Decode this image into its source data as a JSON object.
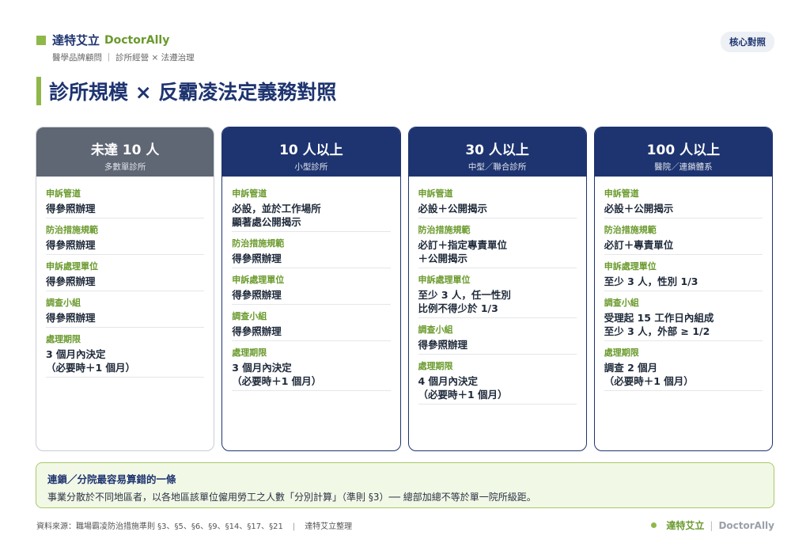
{
  "header": {
    "brand_cn": "達特艾立",
    "brand_en": "DoctorAlly",
    "brand_sub": "醫學品牌顧問 ｜ 診所經營 × 法遵治理",
    "tag": "核心對照"
  },
  "title": "診所規模 × 反霸凌法定義務對照",
  "cards": [
    {
      "title": "未達 10 人",
      "subtitle": "多數單診所",
      "items": [
        {
          "label": "申訴管道",
          "value": "得參照辦理"
        },
        {
          "label": "防治措施規範",
          "value": "得參照辦理"
        },
        {
          "label": "申訴處理單位",
          "value": "得參照辦理"
        },
        {
          "label": "調查小組",
          "value": "得參照辦理"
        },
        {
          "label": "處理期限",
          "value": "3 個月內決定\n（必要時＋1 個月）"
        }
      ]
    },
    {
      "title": "10 人以上",
      "subtitle": "小型診所",
      "items": [
        {
          "label": "申訴管道",
          "value": "必設，並於工作場所\n顯著處公開揭示"
        },
        {
          "label": "防治措施規範",
          "value": "得參照辦理"
        },
        {
          "label": "申訴處理單位",
          "value": "得參照辦理"
        },
        {
          "label": "調查小組",
          "value": "得參照辦理"
        },
        {
          "label": "處理期限",
          "value": "3 個月內決定\n（必要時＋1 個月）"
        }
      ]
    },
    {
      "title": "30 人以上",
      "subtitle": "中型／聯合診所",
      "items": [
        {
          "label": "申訴管道",
          "value": "必設＋公開揭示"
        },
        {
          "label": "防治措施規範",
          "value": "必訂＋指定專責單位\n＋公開揭示"
        },
        {
          "label": "申訴處理單位",
          "value": "至少 3 人，任一性別\n比例不得少於 1/3"
        },
        {
          "label": "調查小組",
          "value": "得參照辦理"
        },
        {
          "label": "處理期限",
          "value": "4 個月內決定\n（必要時＋1 個月）"
        }
      ]
    },
    {
      "title": "100 人以上",
      "subtitle": "醫院／連鎖體系",
      "items": [
        {
          "label": "申訴管道",
          "value": "必設＋公開揭示"
        },
        {
          "label": "防治措施規範",
          "value": "必訂＋專責單位"
        },
        {
          "label": "申訴處理單位",
          "value": "至少 3 人，性別 1/3"
        },
        {
          "label": "調查小組",
          "value": "受理起 15 工作日內組成\n至少 3 人，外部 ≥ 1/2"
        },
        {
          "label": "處理期限",
          "value": "調查 2 個月\n（必要時＋1 個月）"
        }
      ]
    }
  ],
  "note": {
    "title": "連鎖／分院最容易算錯的一條",
    "text": "事業分散於不同地區者，以各地區該單位僱用勞工之人數「分別計算」（準則 §3）── 總部加總不等於單一院所級距。"
  },
  "footer": {
    "source": "資料來源：職場霸凌防治措施準則 §3、§5、§6、§9、§14、§17、§21",
    "compiled": "達特艾立整理",
    "brand_cn": "達特艾立",
    "brand_en": "DoctorAlly"
  }
}
